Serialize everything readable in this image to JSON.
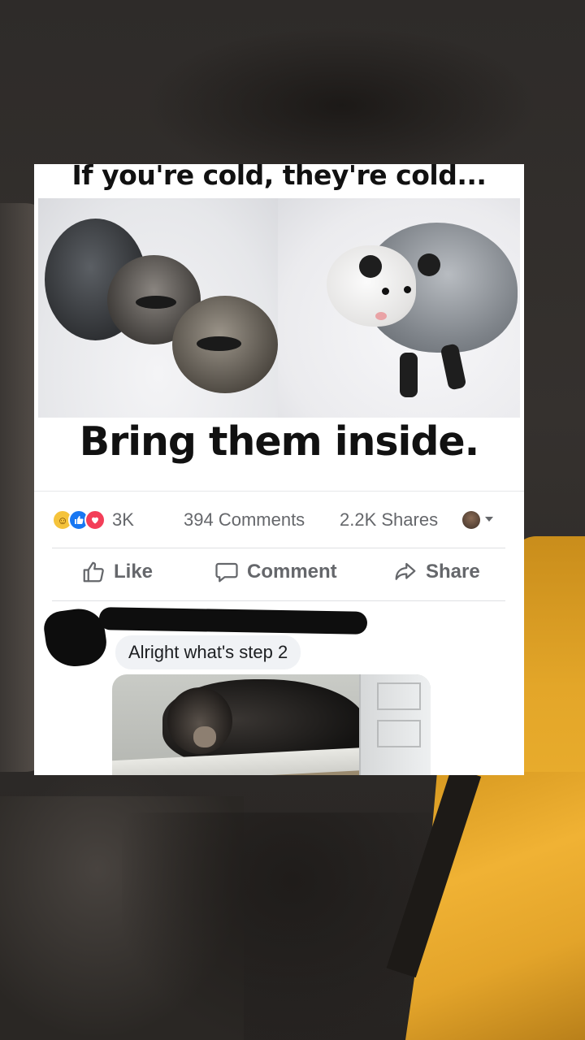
{
  "meme": {
    "top_caption": "If you're cold, they're cold...",
    "bottom_caption": "Bring them inside."
  },
  "post_stats": {
    "reactions": [
      "haha",
      "like",
      "love"
    ],
    "reaction_count": "3K",
    "comments": "394 Comments",
    "shares": "2.2K Shares"
  },
  "actions": {
    "like": "Like",
    "comment": "Comment",
    "share": "Share"
  },
  "comment": {
    "text": "Alright what's step 2"
  },
  "colors": {
    "like_blue": "#1877f2",
    "love_red": "#f33e58",
    "haha_yellow": "#f5c33b",
    "meta_text": "#65676b",
    "bubble_bg": "#f0f2f5"
  }
}
